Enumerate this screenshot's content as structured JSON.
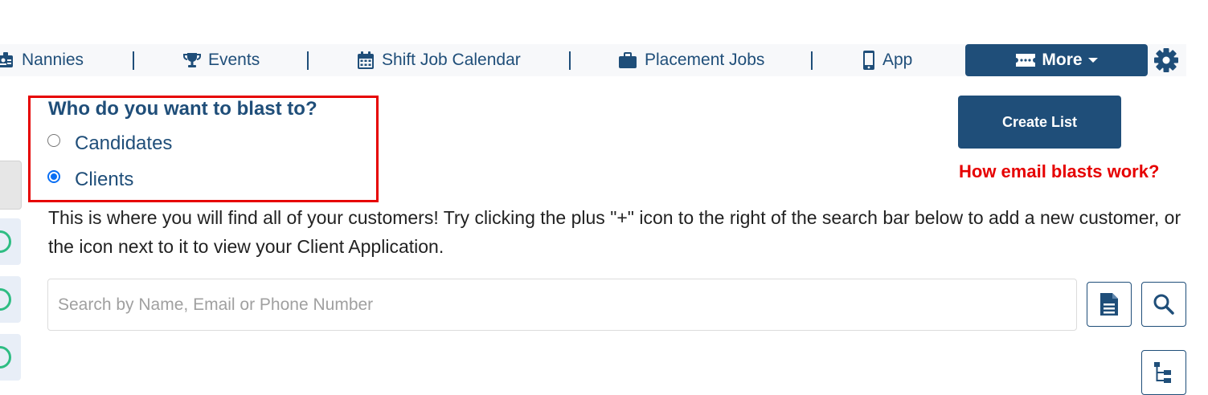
{
  "nav": {
    "items": [
      {
        "label": "Nannies",
        "icon": "id-badge-icon"
      },
      {
        "label": "Events",
        "icon": "trophy-icon"
      },
      {
        "label": "Shift Job Calendar",
        "icon": "calendar-icon"
      },
      {
        "label": "Placement Jobs",
        "icon": "briefcase-icon"
      },
      {
        "label": "App",
        "icon": "mobile-icon"
      }
    ],
    "more_label": "More",
    "settings_icon": "gear-icon"
  },
  "blast": {
    "question": "Who do you want to blast to?",
    "options": [
      {
        "label": "Candidates",
        "selected": false
      },
      {
        "label": "Clients",
        "selected": true
      }
    ]
  },
  "actions": {
    "create_list_label": "Create List",
    "help_link": "How email blasts work?"
  },
  "description": "This is where you will find all of your customers! Try clicking the plus \"+\" icon to the right of the search bar below to add a new customer, or the icon next to it to view your Client Application.",
  "search": {
    "placeholder": "Search by Name, Email or Phone Number",
    "value": ""
  },
  "colors": {
    "primary": "#1f4e79",
    "alert": "#e60000",
    "radio_accent": "#0a6ff4",
    "status_green": "#2ebd83"
  }
}
